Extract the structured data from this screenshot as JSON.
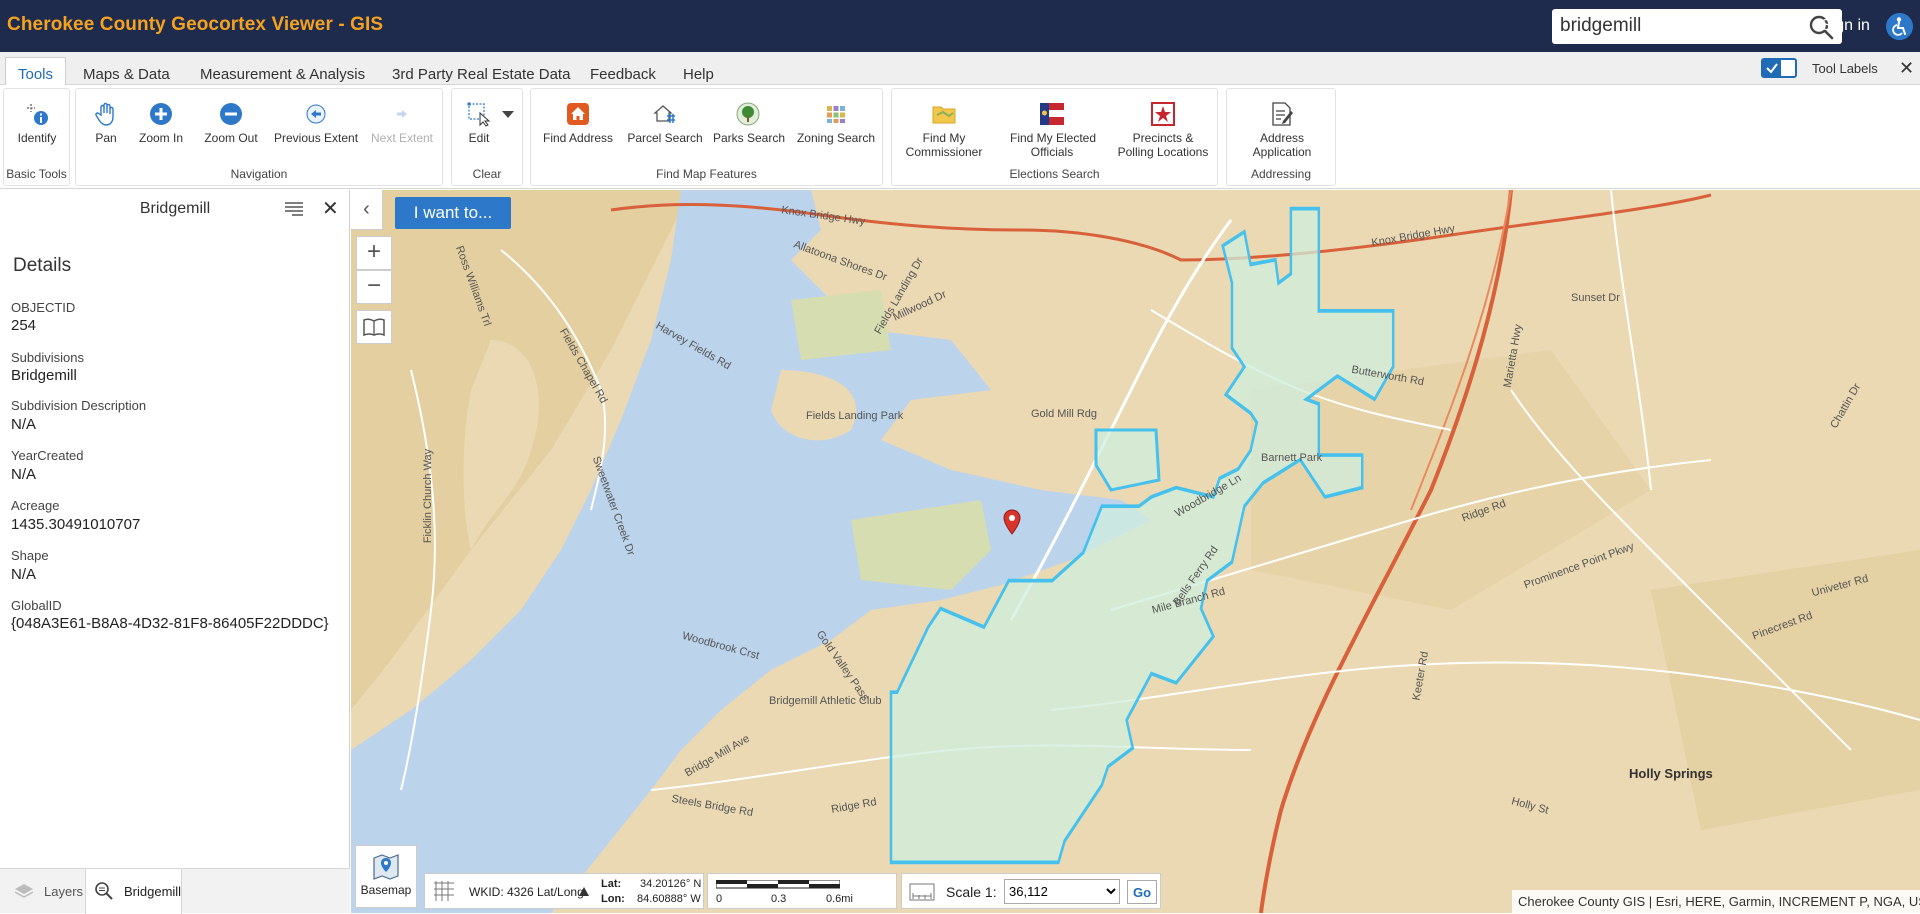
{
  "header": {
    "title": "Cherokee County Geocortex Viewer - GIS",
    "search_value": "bridgemill",
    "sign_in": "Sign in"
  },
  "tabs": [
    {
      "label": "Tools"
    },
    {
      "label": "Maps & Data"
    },
    {
      "label": "Measurement & Analysis"
    },
    {
      "label": "3rd Party Real Estate Data"
    },
    {
      "label": "Feedback"
    },
    {
      "label": "Help"
    }
  ],
  "tool_labels": "Tool Labels",
  "toolbar": {
    "groups": [
      {
        "label": "Basic Tools",
        "tools": [
          "Identify"
        ]
      },
      {
        "label": "Navigation",
        "tools": [
          "Pan",
          "Zoom In",
          "Zoom Out",
          "Previous Extent",
          "Next Extent"
        ]
      },
      {
        "label": "Clear",
        "tools": [
          "Edit"
        ]
      },
      {
        "label": "Find Map Features",
        "tools": [
          "Find Address",
          "Parcel Search",
          "Parks Search",
          "Zoning Search"
        ]
      },
      {
        "label": "Elections Search",
        "tools": [
          "Find My Commissioner",
          "Find My Elected Officials",
          "Precincts & Polling Locations"
        ]
      },
      {
        "label": "Addressing",
        "tools": [
          "Address Application"
        ]
      }
    ],
    "tool_lines": {
      "find_my_commissioner": [
        "Find My",
        "Commissioner"
      ],
      "find_my_elected": [
        "Find My Elected",
        "Officials"
      ],
      "precincts": [
        "Precincts &",
        "Polling Locations"
      ],
      "address_application": [
        "Address",
        "Application"
      ]
    }
  },
  "panel": {
    "title": "Bridgemill",
    "details_heading": "Details",
    "fields": [
      {
        "label": "OBJECTID",
        "value": "254"
      },
      {
        "label": "Subdivisions",
        "value": "Bridgemill"
      },
      {
        "label": "Subdivision Description",
        "value": "N/A"
      },
      {
        "label": "YearCreated",
        "value": "N/A"
      },
      {
        "label": "Acreage",
        "value": "1435.30491010707"
      },
      {
        "label": "Shape",
        "value": "N/A"
      },
      {
        "label": "GlobalID",
        "value": "{048A3E61-B8A8-4D32-81F8-86405F22DDDC}"
      }
    ],
    "footer_tabs": [
      {
        "label": "Layers"
      },
      {
        "label": "Bridgemill"
      }
    ]
  },
  "map": {
    "iwant": "I want to...",
    "basemap": "Basemap",
    "wkid": "WKID: 4326 Lat/Long",
    "lat_label": "Lat:",
    "lat_value": "34.20126° N",
    "lon_label": "Lon:",
    "lon_value": "84.60888° W",
    "scale_ticks": [
      "0",
      "0.3",
      "0.6mi"
    ],
    "scale_label": "Scale 1:",
    "scale_value": "36,112",
    "go": "Go",
    "attribution": "Cherokee County GIS | Esri, HERE, Garmin, INCREMENT P, NGA, USGS",
    "labels": [
      "Knox Bridge Hwy",
      "Knox Bridge Hwy",
      "Bells Ferry Rd",
      "Butterworth Rd",
      "Sunset Dr",
      "Marietta Hwy",
      "Ross Williams Trl",
      "Harvey Fields Rd",
      "Fields Chapel Rd",
      "Sweetwater Creek Dr",
      "Ficklin Church Way",
      "Millwood Dr",
      "Gold Mill Rdg",
      "Barnett Park",
      "Fields Landing Park",
      "Woodbridge Ln",
      "Ridge Rd",
      "Prominence Point Pkwy",
      "Mile Branch Rd",
      "Woodbrook Crst",
      "Gold Valley Pass",
      "Bridgemill Athletic Club",
      "Bridge Mill Ave",
      "Steels Bridge Rd",
      "Ridge Rd",
      "Holly Springs",
      "Holly St",
      "Pinecrest Rd",
      "Univeter Rd",
      "Chattin Dr",
      "Keeter Rd",
      "Allatoona Shores Dr",
      "Fields Landing Dr"
    ],
    "colors": {
      "land": "#ead9b2",
      "water": "#bcd3ec",
      "boundary": "#46c1ee",
      "fill": "#cfeedd",
      "road_major": "#d8603a",
      "road_minor": "#ffffff"
    }
  }
}
